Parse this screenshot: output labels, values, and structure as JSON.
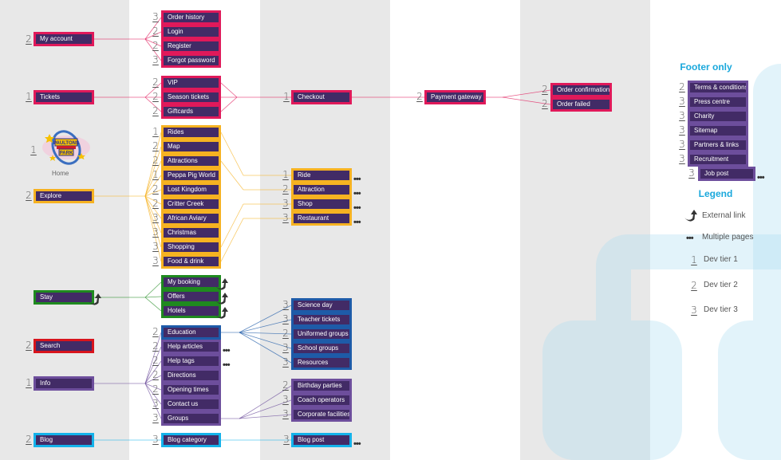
{
  "colors": {
    "account": "#e0195a",
    "explore": "#f6b221",
    "stay": "#1f8a1f",
    "search": "#d8141c",
    "education": "#1e5ba8",
    "info": "#6d4e9c",
    "blog": "#14b2ea",
    "node_fill": "#422b66",
    "heading": "#1aa8dc"
  },
  "home": {
    "tier": "1",
    "label": "Home",
    "logo_alt": "Paultons Park logo"
  },
  "level1": {
    "my_account": {
      "tier": "2",
      "label": "My account"
    },
    "tickets": {
      "tier": "1",
      "label": "Tickets"
    },
    "explore": {
      "tier": "2",
      "label": "Explore"
    },
    "stay": {
      "label": "Stay"
    },
    "search": {
      "tier": "2",
      "label": "Search"
    },
    "info": {
      "tier": "1",
      "label": "Info"
    },
    "blog": {
      "tier": "2",
      "label": "Blog"
    }
  },
  "level2": {
    "account": [
      {
        "tier": "3",
        "label": "Order history"
      },
      {
        "tier": "2",
        "label": "Login"
      },
      {
        "tier": "2",
        "label": "Register"
      },
      {
        "tier": "3",
        "label": "Forgot password"
      }
    ],
    "tickets": [
      {
        "tier": "2",
        "label": "VIP"
      },
      {
        "tier": "2",
        "label": "Season tickets"
      },
      {
        "tier": "2",
        "label": "Giftcards"
      }
    ],
    "explore": [
      {
        "tier": "1",
        "label": "Rides"
      },
      {
        "tier": "2",
        "label": "Map"
      },
      {
        "tier": "2",
        "label": "Attractions"
      },
      {
        "tier": "1",
        "label": "Peppa Pig World"
      },
      {
        "tier": "2",
        "label": "Lost Kingdom"
      },
      {
        "tier": "2",
        "label": "Critter Creek"
      },
      {
        "tier": "3",
        "label": "African Aviary"
      },
      {
        "tier": "3",
        "label": "Christmas"
      },
      {
        "tier": "3",
        "label": "Shopping"
      },
      {
        "tier": "3",
        "label": "Food & drink"
      }
    ],
    "stay": [
      {
        "label": "My booking"
      },
      {
        "label": "Offers"
      },
      {
        "label": "Hotels"
      }
    ],
    "info": [
      {
        "tier": "2",
        "label": "Education"
      },
      {
        "tier": "2",
        "label": "Help articles",
        "multiple": "•••"
      },
      {
        "tier": "2",
        "label": "Help tags",
        "multiple": "•••"
      },
      {
        "tier": "2",
        "label": "Directions"
      },
      {
        "tier": "2",
        "label": "Opening times"
      },
      {
        "tier": "3",
        "label": "Contact us"
      },
      {
        "tier": "3",
        "label": "Groups"
      }
    ],
    "blog": [
      {
        "tier": "3",
        "label": "Blog category"
      }
    ]
  },
  "level3": {
    "checkout": {
      "tier": "1",
      "label": "Checkout"
    },
    "explore_detail": [
      {
        "tier": "1",
        "label": "Ride",
        "multiple": "•••"
      },
      {
        "tier": "2",
        "label": "Attraction",
        "multiple": "•••"
      },
      {
        "tier": "3",
        "label": "Shop",
        "multiple": "•••"
      },
      {
        "tier": "3",
        "label": "Restaurant",
        "multiple": "•••"
      }
    ],
    "education": [
      {
        "tier": "3",
        "label": "Science day"
      },
      {
        "tier": "3",
        "label": "Teacher tickets"
      },
      {
        "tier": "2",
        "label": "Uniformed groups"
      },
      {
        "tier": "3",
        "label": "School groups"
      },
      {
        "tier": "3",
        "label": "Resources"
      }
    ],
    "groups": [
      {
        "tier": "2",
        "label": "Birthday parties"
      },
      {
        "tier": "3",
        "label": "Coach operators"
      },
      {
        "tier": "3",
        "label": "Corporate facilities"
      }
    ],
    "blog_post": {
      "tier": "3",
      "label": "Blog post",
      "multiple": "•••"
    }
  },
  "level4": {
    "payment": {
      "tier": "2",
      "label": "Payment gateway"
    }
  },
  "level5": [
    {
      "tier": "2",
      "label": "Order confirmation"
    },
    {
      "tier": "2",
      "label": "Order failed"
    }
  ],
  "footer": {
    "heading": "Footer only",
    "items": [
      {
        "tier": "2",
        "label": "Terms & conditions"
      },
      {
        "tier": "3",
        "label": "Press centre"
      },
      {
        "tier": "3",
        "label": "Charity"
      },
      {
        "tier": "3",
        "label": "Sitemap"
      },
      {
        "tier": "3",
        "label": "Partners & links"
      },
      {
        "tier": "3",
        "label": "Recruitment"
      }
    ],
    "sub": {
      "tier": "3",
      "label": "Job post",
      "multiple": "•••"
    }
  },
  "legend": {
    "heading": "Legend",
    "external_link": "External link",
    "multiple_pages": "Multiple pages",
    "multiple_symbol": "•••",
    "tier1": {
      "tier": "1",
      "label": "Dev tier 1"
    },
    "tier2": {
      "tier": "2",
      "label": "Dev tier 2"
    },
    "tier3": {
      "tier": "3",
      "label": "Dev tier 3"
    }
  }
}
